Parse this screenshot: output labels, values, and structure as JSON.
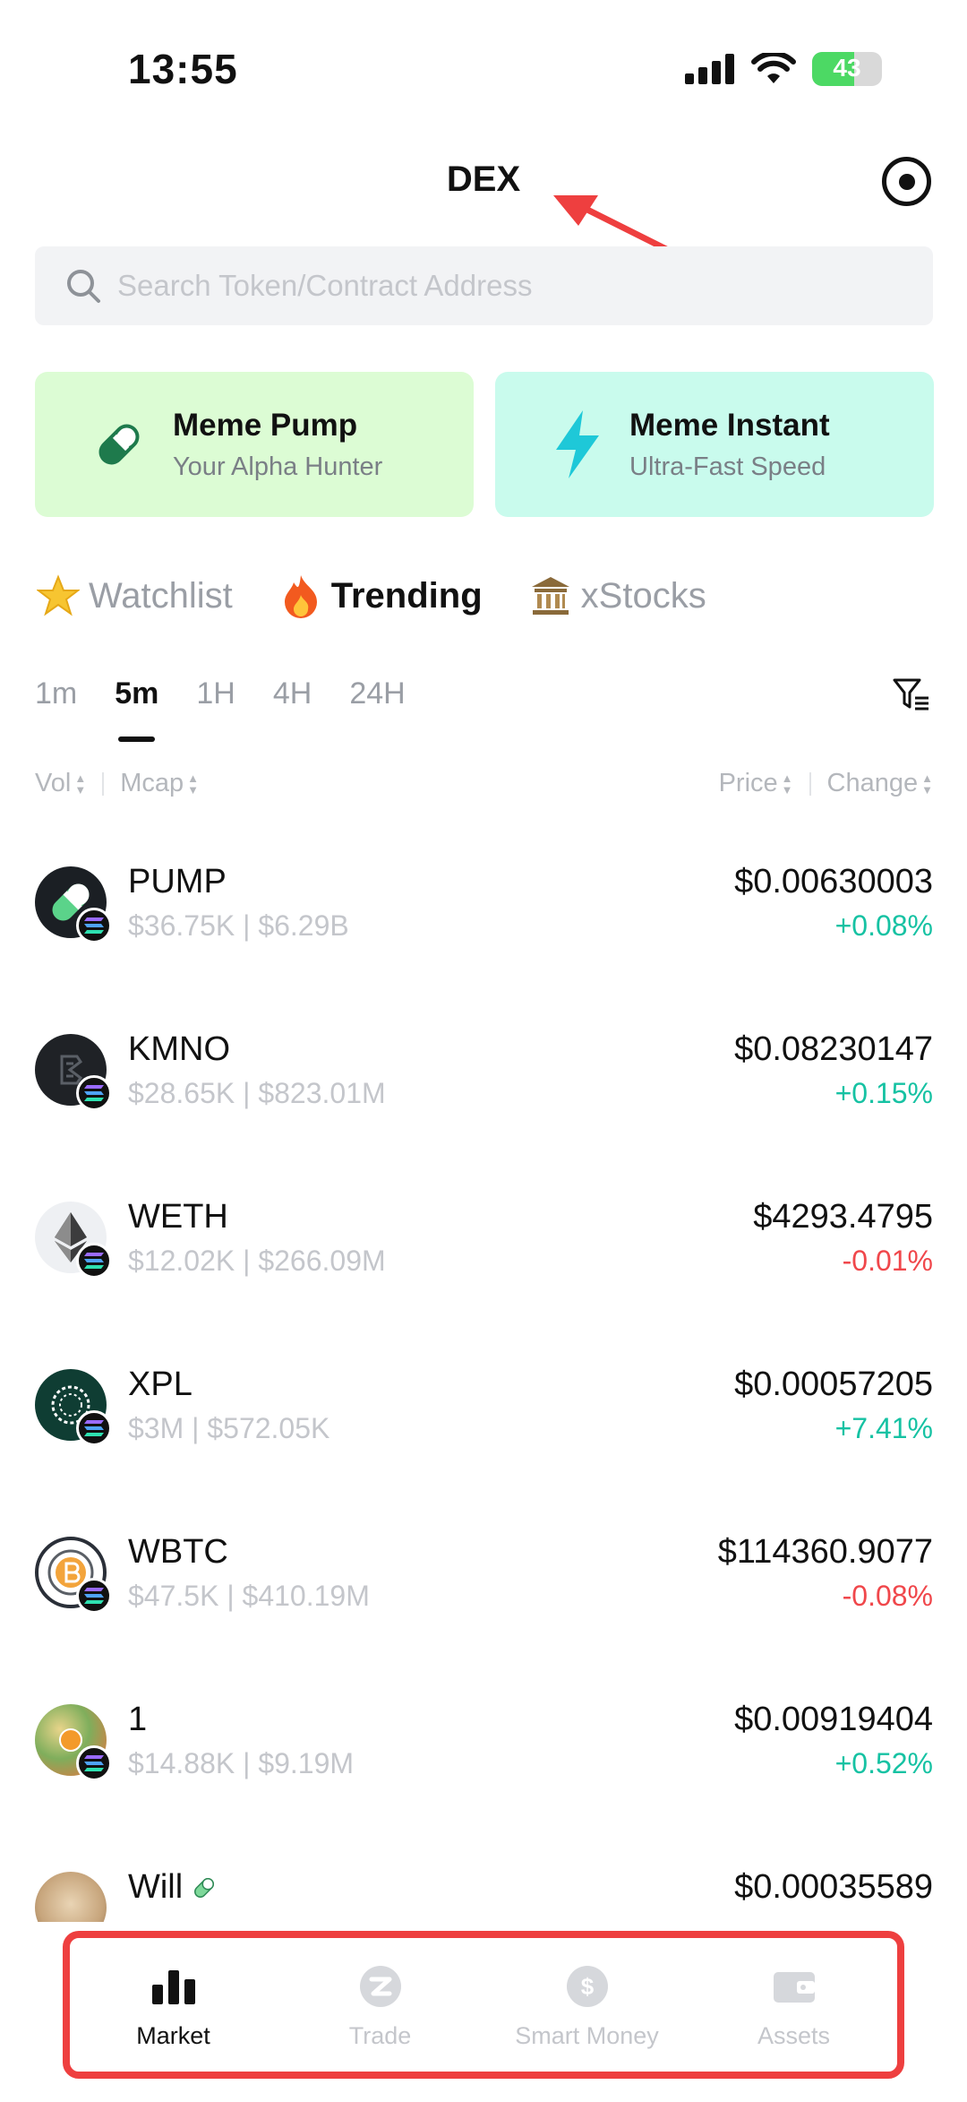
{
  "status_bar": {
    "time": "13:55",
    "battery": "43"
  },
  "header": {
    "title": "DEX",
    "settings_icon": "target-icon"
  },
  "search": {
    "placeholder": "Search Token/Contract Address"
  },
  "promos": [
    {
      "title": "Meme Pump",
      "subtitle": "Your Alpha Hunter",
      "icon": "pill-icon",
      "bg": "#dcfcd4"
    },
    {
      "title": "Meme Instant",
      "subtitle": "Ultra-Fast Speed",
      "icon": "lightning-icon",
      "bg": "#c9fbed"
    }
  ],
  "category_tabs": [
    {
      "label": "Watchlist",
      "emoji": "⭐",
      "active": false
    },
    {
      "label": "Trending",
      "emoji": "🔥",
      "active": true
    },
    {
      "label": "xStocks",
      "emoji": "🏛",
      "active": false
    }
  ],
  "time_tabs": [
    "1m",
    "5m",
    "1H",
    "4H",
    "24H"
  ],
  "time_tab_active": "5m",
  "sort_header": {
    "vol": "Vol",
    "mcap": "Mcap",
    "price": "Price",
    "change": "Change"
  },
  "tokens": [
    {
      "name": "PUMP",
      "meta": "$36.75K | $6.29B",
      "price": "$0.00630003",
      "change": "+0.08%",
      "direction": "up"
    },
    {
      "name": "KMNO",
      "meta": "$28.65K | $823.01M",
      "price": "$0.08230147",
      "change": "+0.15%",
      "direction": "up"
    },
    {
      "name": "WETH",
      "meta": "$12.02K | $266.09M",
      "price": "$4293.4795",
      "change": "-0.01%",
      "direction": "down"
    },
    {
      "name": "XPL",
      "meta": "$3M | $572.05K",
      "price": "$0.00057205",
      "change": "+7.41%",
      "direction": "up"
    },
    {
      "name": "WBTC",
      "meta": "$47.5K | $410.19M",
      "price": "$114360.9077",
      "change": "-0.08%",
      "direction": "down"
    },
    {
      "name": "1",
      "meta": "$14.88K | $9.19M",
      "price": "$0.00919404",
      "change": "+0.52%",
      "direction": "up"
    },
    {
      "name": "Will",
      "meta": "",
      "price": "$0.00035589",
      "change": "",
      "direction": "up"
    }
  ],
  "bottom_nav": [
    {
      "label": "Market",
      "icon": "bar-chart-icon",
      "active": true
    },
    {
      "label": "Trade",
      "icon": "trade-icon",
      "active": false
    },
    {
      "label": "Smart Money",
      "icon": "dollar-coin-icon",
      "active": false
    },
    {
      "label": "Assets",
      "icon": "wallet-icon",
      "active": false
    }
  ],
  "colors": {
    "up": "#16c2a3",
    "down": "#f0474b",
    "annotation": "#ee3f3f"
  }
}
